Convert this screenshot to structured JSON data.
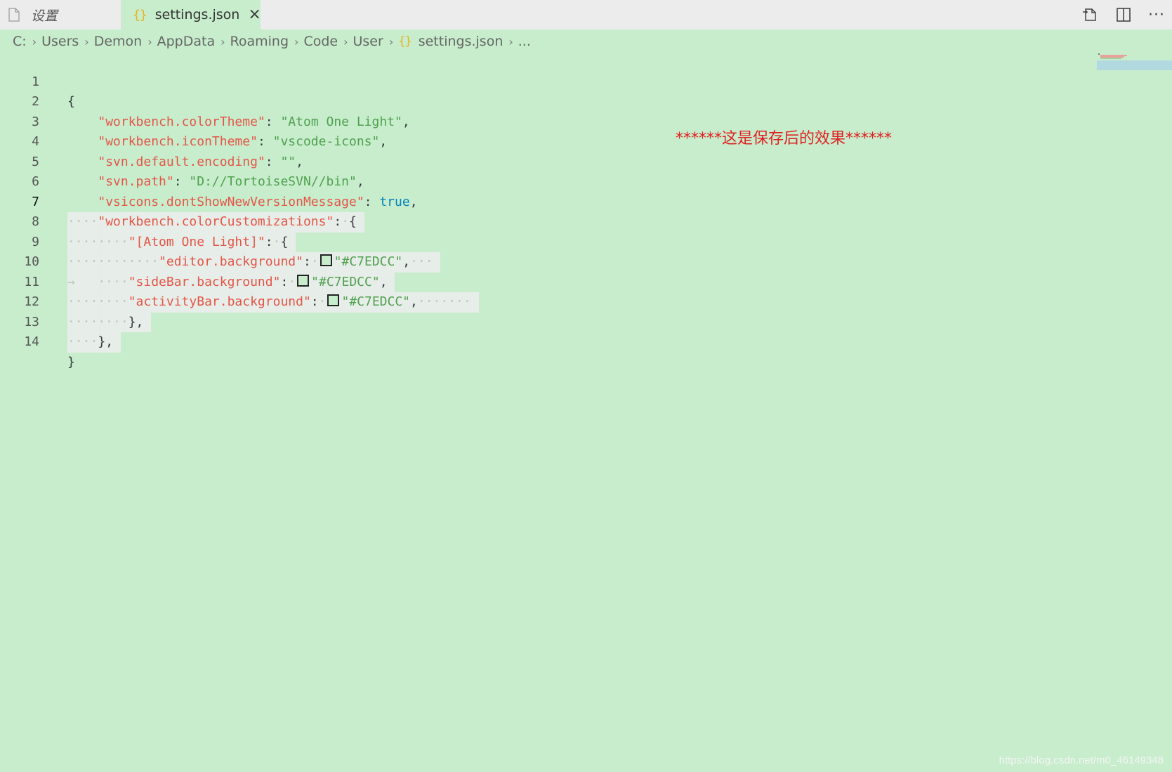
{
  "colors": {
    "editor_bg": "#C7EDCC",
    "tabbar_bg": "#ececec",
    "key": "#e45649",
    "string": "#50a14f",
    "keyword": "#0184bc",
    "annotation": "#e02020"
  },
  "tabs": [
    {
      "label": "设置",
      "icon": "file-icon",
      "active": false
    },
    {
      "label": "settings.json",
      "icon": "json-braces-icon",
      "active": true,
      "close": "×"
    }
  ],
  "tab_actions": [
    "open-preview-icon",
    "split-editor-icon",
    "more-actions-icon"
  ],
  "breadcrumb": [
    "C:",
    "Users",
    "Demon",
    "AppData",
    "Roaming",
    "Code",
    "User",
    "settings.json",
    "..."
  ],
  "breadcrumb_separator": "›",
  "json_icon_glyph": "{}",
  "editor": {
    "current_line": 7,
    "lines": [
      {
        "n": "1"
      },
      {
        "n": "2"
      },
      {
        "n": "3"
      },
      {
        "n": "4"
      },
      {
        "n": "5"
      },
      {
        "n": "6"
      },
      {
        "n": "7"
      },
      {
        "n": "8"
      },
      {
        "n": "9"
      },
      {
        "n": "10"
      },
      {
        "n": "11"
      },
      {
        "n": "12"
      },
      {
        "n": "13"
      },
      {
        "n": "14"
      }
    ],
    "keys": {
      "colorTheme": "\"workbench.colorTheme\"",
      "iconTheme": "\"workbench.iconTheme\"",
      "encoding": "\"svn.default.encoding\"",
      "svnPath": "\"svn.path\"",
      "dontShow": "\"vsicons.dontShowNewVersionMessage\"",
      "colorCustomizations": "\"workbench.colorCustomizations\"",
      "themeScope": "\"[Atom One Light]\"",
      "editorBg": "\"editor.background\"",
      "sideBarBg": "\"sideBar.background\"",
      "activityBarBg": "\"activityBar.background\""
    },
    "values": {
      "colorTheme": "\"Atom One Light\"",
      "iconTheme": "\"vscode-icons\"",
      "encoding": "\"\"",
      "svnPath": "\"D://TortoiseSVN//bin\"",
      "dontShow": "true",
      "editorBg": "\"#C7EDCC\"",
      "sideBarBg": "\"#C7EDCC\"",
      "activityBarBg": "\"#C7EDCC\""
    }
  },
  "annotation": "******这是保存后的效果******",
  "watermark": "https://blog.csdn.net/m0_46149348"
}
